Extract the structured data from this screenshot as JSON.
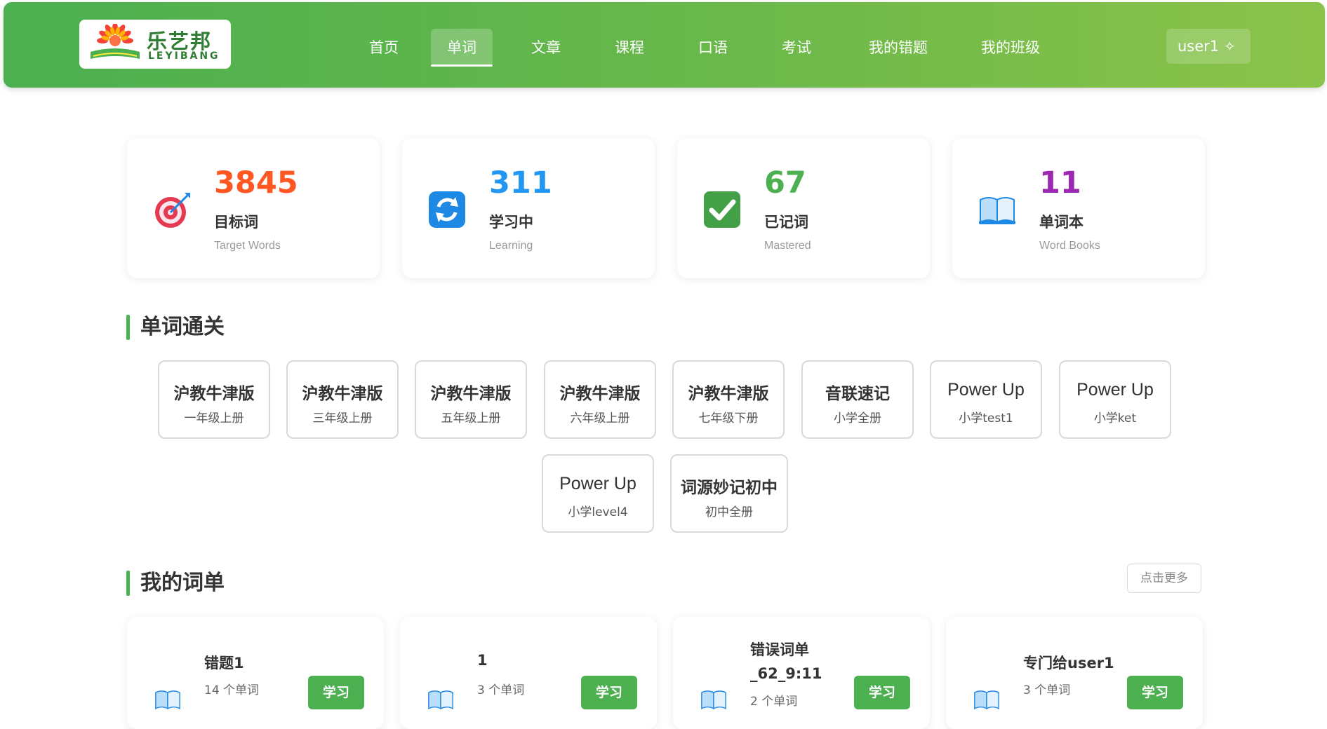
{
  "header": {
    "logo_cn": "乐艺邦",
    "logo_en": "LEYIBANG",
    "nav": [
      "首页",
      "单词",
      "文章",
      "课程",
      "口语",
      "考试",
      "我的错题",
      "我的班级"
    ],
    "active_nav": "单词",
    "user": "user1",
    "user_icon": "sparkle-icon"
  },
  "stats": [
    {
      "value": "3845",
      "label": "目标词",
      "sub": "Target Words",
      "color": "#ff5722",
      "icon": "target-icon"
    },
    {
      "value": "311",
      "label": "学习中",
      "sub": "Learning",
      "color": "#2196f3",
      "icon": "refresh-icon"
    },
    {
      "value": "67",
      "label": "已记词",
      "sub": "Mastered",
      "color": "#4caf50",
      "icon": "check-icon"
    },
    {
      "value": "11",
      "label": "单词本",
      "sub": "Word Books",
      "color": "#9c27b0",
      "icon": "book-icon"
    }
  ],
  "word_pass": {
    "title": "单词通关",
    "books": [
      {
        "title": "沪教牛津版",
        "sub": "一年级上册"
      },
      {
        "title": "沪教牛津版",
        "sub": "三年级上册"
      },
      {
        "title": "沪教牛津版",
        "sub": "五年级上册"
      },
      {
        "title": "沪教牛津版",
        "sub": "六年级上册"
      },
      {
        "title": "沪教牛津版",
        "sub": "七年级下册"
      },
      {
        "title": "音联速记",
        "sub": "小学全册"
      },
      {
        "title": "Power Up",
        "sub": "小学test1"
      },
      {
        "title": "Power Up",
        "sub": "小学ket"
      },
      {
        "title": "Power Up",
        "sub": "小学level4"
      },
      {
        "title": "词源妙记初中",
        "sub": "初中全册"
      }
    ]
  },
  "my_lists": {
    "title": "我的词单",
    "more": "点击更多",
    "study_label": "学习",
    "lists": [
      {
        "name": "错题1",
        "count": "14 个单词"
      },
      {
        "name": "1",
        "count": "3 个单词"
      },
      {
        "name": "错误词单_62_9:11",
        "count": "2 个单词"
      },
      {
        "name": "专门给user1",
        "count": "3 个单词"
      }
    ]
  }
}
